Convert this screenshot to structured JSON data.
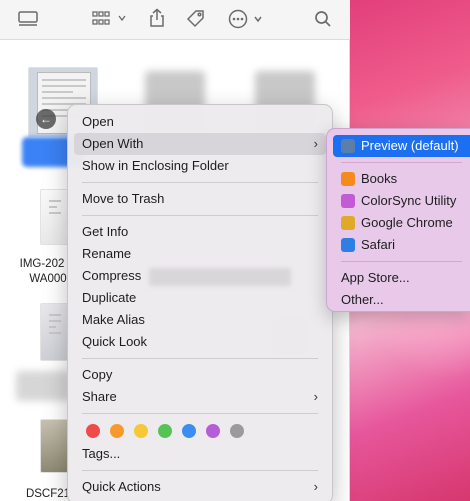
{
  "desktop": {},
  "file_labels": {
    "file2_line1": "IMG-202",
    "file2_line2": "WA000",
    "file4": "DSCF21"
  },
  "context_menu": {
    "open": "Open",
    "open_with": "Open With",
    "show_enclosing": "Show in Enclosing Folder",
    "move_to_trash": "Move to Trash",
    "get_info": "Get Info",
    "rename": "Rename",
    "compress": "Compress",
    "duplicate": "Duplicate",
    "make_alias": "Make Alias",
    "quick_look": "Quick Look",
    "copy": "Copy",
    "share": "Share",
    "tags": "Tags...",
    "quick_actions": "Quick Actions",
    "submenu_arrow": "›",
    "tag_colors": [
      "#ef4b4b",
      "#f79a2d",
      "#f7c835",
      "#56c454",
      "#3b8df0",
      "#b45fd6",
      "#9b9b9b"
    ]
  },
  "open_with_submenu": {
    "items": [
      {
        "label": "Preview (default)",
        "icon": "preview-app-icon",
        "color": "#5b7fa8"
      },
      {
        "label": "Books",
        "icon": "books-app-icon",
        "color": "#f58a1f"
      },
      {
        "label": "ColorSync Utility",
        "icon": "colorsync-app-icon",
        "color": "#c35ad6"
      },
      {
        "label": "Google Chrome",
        "icon": "chrome-app-icon",
        "color": "#e0a92a"
      },
      {
        "label": "Safari",
        "icon": "safari-app-icon",
        "color": "#2f7ee6"
      }
    ],
    "app_store": "App Store...",
    "other": "Other..."
  },
  "accent_color": "#1d6ff2"
}
